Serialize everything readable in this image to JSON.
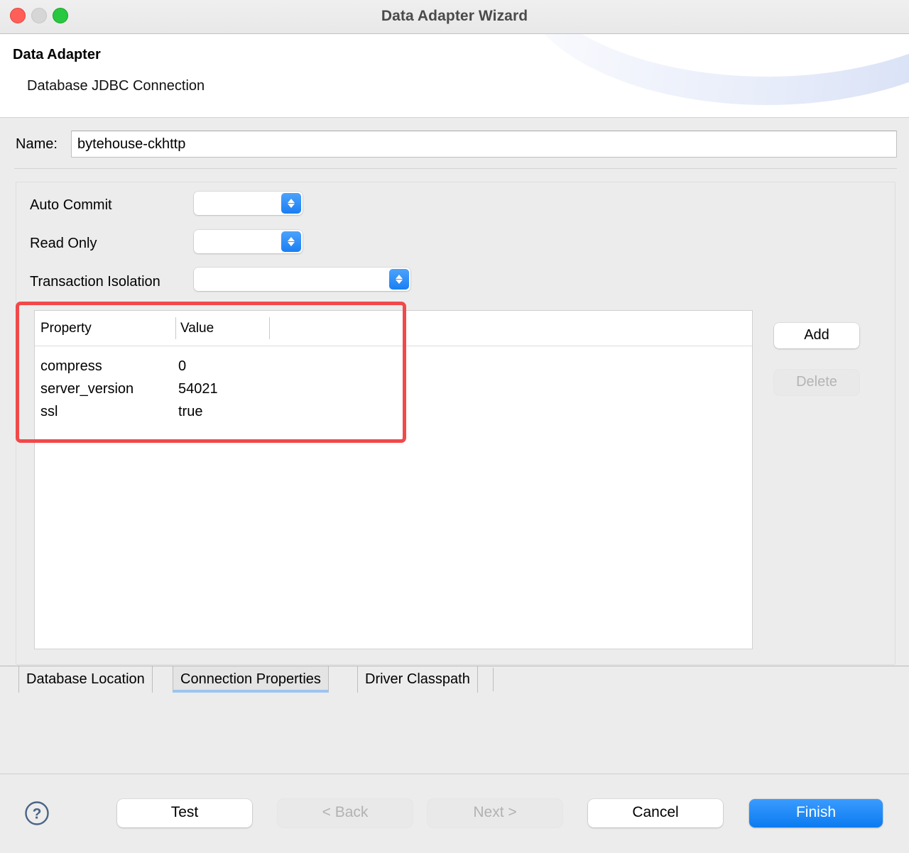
{
  "window": {
    "title": "Data Adapter Wizard",
    "controls": {
      "close": "close-button",
      "minimize": "minimize-button",
      "maximize": "maximize-button"
    }
  },
  "header": {
    "title": "Data Adapter",
    "subtitle": "Database JDBC Connection"
  },
  "name_field": {
    "label": "Name:",
    "value": "bytehouse-ckhttp",
    "placeholder": ""
  },
  "form": {
    "rows": [
      {
        "label": "Auto Commit",
        "value": ""
      },
      {
        "label": "Read Only",
        "value": ""
      },
      {
        "label": "Transaction Isolation",
        "value": ""
      }
    ]
  },
  "table": {
    "columns": [
      "Property",
      "Value"
    ],
    "rows": [
      {
        "property": "compress",
        "value": "0"
      },
      {
        "property": "server_version",
        "value": "54021"
      },
      {
        "property": "ssl",
        "value": "true"
      }
    ]
  },
  "side_buttons": {
    "add": "Add",
    "delete": "Delete"
  },
  "tabs": [
    {
      "label": "Database Location",
      "active": false
    },
    {
      "label": "Connection Properties",
      "active": true
    },
    {
      "label": "Driver Classpath",
      "active": false
    }
  ],
  "footer": {
    "help": "?",
    "test": "Test",
    "back": "< Back",
    "next": "Next >",
    "cancel": "Cancel",
    "finish": "Finish"
  },
  "colors": {
    "accent": "#0b7bf0",
    "stepper": "#1a7ff3",
    "annotation": "#f1494a",
    "active_tab_underline": "#9dc4ef",
    "window_bg": "#ececec"
  }
}
